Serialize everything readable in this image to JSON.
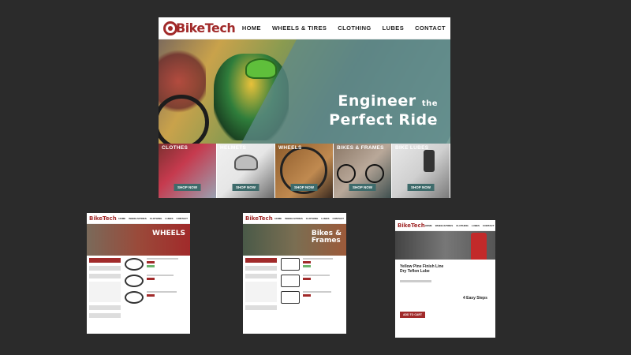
{
  "main": {
    "logo": "BikeTech",
    "nav": [
      "HOME",
      "WHEELS & TIRES",
      "CLOTHING",
      "LUBES",
      "CONTACT"
    ],
    "hero": {
      "line1": "Engineer",
      "the": "the",
      "line2": "Perfect Ride"
    },
    "tiles": [
      {
        "title": "CLOTHES",
        "button": "SHOP NOW"
      },
      {
        "title": "HELMETS",
        "button": "SHOP NOW"
      },
      {
        "title": "WHEELS",
        "button": "SHOP NOW"
      },
      {
        "title": "BIKES & FRAMES",
        "button": "SHOP NOW"
      },
      {
        "title": "BIKE LUBES",
        "button": "SHOP NOW"
      }
    ]
  },
  "mini1": {
    "logo": "BikeTech",
    "nav": [
      "HOME",
      "WHEELS/TIRES",
      "CLOTHING",
      "LUBES",
      "CONTACT"
    ],
    "banner": "WHEELS"
  },
  "mini2": {
    "logo": "BikeTech",
    "nav": [
      "HOME",
      "WHEELS/TIRES",
      "CLOTHING",
      "LUBES",
      "CONTACT"
    ],
    "banner_line1": "Bikes &",
    "banner_line2": "Frames"
  },
  "mini3": {
    "logo": "BikeTech",
    "nav": [
      "HOME",
      "WHEELS/TIRES",
      "CLOTHING",
      "LUBES",
      "CONTACT"
    ],
    "product": "Yellow Pine Finish Line Dry Teflon Lube",
    "steps_title": "4 Easy Steps",
    "cart": "ADD TO CART"
  },
  "colors": {
    "brand": "#a12a2a",
    "teal": "#3e6b6b",
    "bg": "#2b2b2b"
  }
}
